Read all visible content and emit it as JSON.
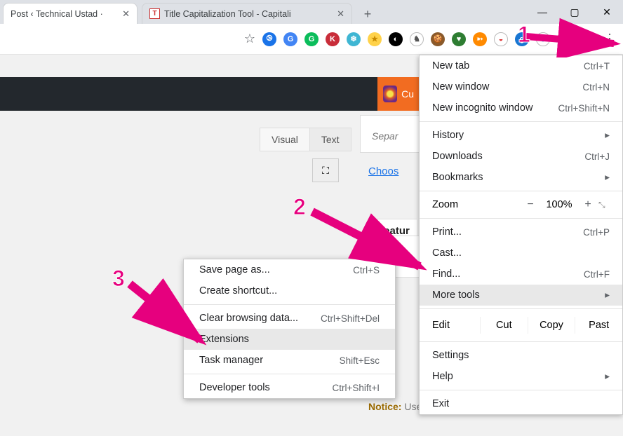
{
  "tabs": [
    {
      "title": "Post ‹ Technical Ustad ·",
      "close": "✕"
    },
    {
      "title": "Title Capitalization Tool - Capitali",
      "favicon": "T",
      "close": "✕"
    }
  ],
  "window_controls": {
    "minimize": "—",
    "maximize": "▢",
    "close": "✕"
  },
  "newtab": "+",
  "star": "☆",
  "overflow": "⋮",
  "ext_icons": [
    {
      "bg": "#1a73e8",
      "char": "⧁"
    },
    {
      "bg": "#4285f4",
      "char": "G"
    },
    {
      "bg": "#0bbd5b",
      "char": "G"
    },
    {
      "bg": "#c92d3a",
      "char": "K"
    },
    {
      "bg": "#3fb6d3",
      "char": "❄"
    },
    {
      "bg": "#ffd24a",
      "char": "★",
      "text": "#c78a00"
    },
    {
      "bg": "#000000",
      "char": "◐"
    },
    {
      "bg": "#ffffff",
      "char": "♞",
      "text": "#555",
      "border": true
    },
    {
      "bg": "#8a5a2b",
      "char": "🍪",
      "text": "#fff"
    },
    {
      "bg": "#2e7d32",
      "char": "♥"
    },
    {
      "bg": "#ff8a00",
      "char": "➳"
    },
    {
      "bg": "#ffffff",
      "char": "◒",
      "text": "#d33",
      "border": true
    },
    {
      "bg": "#1976d2",
      "char": "g"
    },
    {
      "bg": "#ffffff",
      "char": "✚",
      "text": "#1a73e8",
      "border": true
    },
    {
      "bg": "#000000",
      "char": "✪"
    },
    {
      "bg": "#555555",
      "char": "☺"
    }
  ],
  "page": {
    "orange_label": "Cu",
    "visual": "Visual",
    "text": "Text",
    "fullscreen": "⛶",
    "separ": "Separ",
    "choose": "Choos",
    "featur": "Featur",
    "notice_prefix": "Notice:",
    "notice_text": " Use only with those post templates:"
  },
  "menu": {
    "new_tab": {
      "label": "New tab",
      "shortcut": "Ctrl+T"
    },
    "new_window": {
      "label": "New window",
      "shortcut": "Ctrl+N"
    },
    "new_incognito": {
      "label": "New incognito window",
      "shortcut": "Ctrl+Shift+N"
    },
    "history": {
      "label": "History",
      "arrow": "▸"
    },
    "downloads": {
      "label": "Downloads",
      "shortcut": "Ctrl+J"
    },
    "bookmarks": {
      "label": "Bookmarks",
      "arrow": "▸"
    },
    "zoom": {
      "label": "Zoom",
      "minus": "−",
      "value": "100%",
      "plus": "+",
      "full": "⤡"
    },
    "print": {
      "label": "Print...",
      "shortcut": "Ctrl+P"
    },
    "cast": {
      "label": "Cast..."
    },
    "find": {
      "label": "Find...",
      "shortcut": "Ctrl+F"
    },
    "more_tools": {
      "label": "More tools",
      "arrow": "▸"
    },
    "edit": {
      "label": "Edit",
      "cut": "Cut",
      "copy": "Copy",
      "paste": "Past"
    },
    "settings": {
      "label": "Settings"
    },
    "help": {
      "label": "Help",
      "arrow": "▸"
    },
    "exit": {
      "label": "Exit"
    }
  },
  "submenu": {
    "save_page": {
      "label": "Save page as...",
      "shortcut": "Ctrl+S"
    },
    "create_shortcut": {
      "label": "Create shortcut..."
    },
    "clear_data": {
      "label": "Clear browsing data...",
      "shortcut": "Ctrl+Shift+Del"
    },
    "extensions": {
      "label": "Extensions"
    },
    "task_mgr": {
      "label": "Task manager",
      "shortcut": "Shift+Esc"
    },
    "dev_tools": {
      "label": "Developer tools",
      "shortcut": "Ctrl+Shift+I"
    }
  },
  "annotations": {
    "one": "1",
    "two": "2",
    "three": "3"
  }
}
